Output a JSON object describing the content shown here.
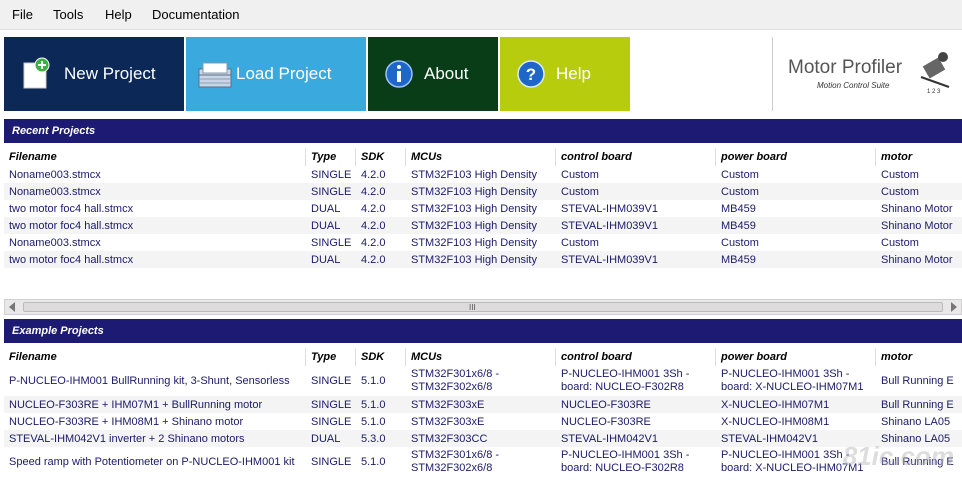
{
  "menu": [
    "File",
    "Tools",
    "Help",
    "Documentation"
  ],
  "toolbar": {
    "new_project": "New Project",
    "load_project": "Load Project",
    "about": "About",
    "help": "Help",
    "colors": {
      "new": "#0b2857",
      "load": "#3aa9de",
      "about": "#093d18",
      "help": "#b6cc0c"
    }
  },
  "logo": {
    "title": "Motor Profiler",
    "subtitle": "Motion Control Suite"
  },
  "recent": {
    "title": "Recent Projects",
    "columns": [
      "Filename",
      "Type",
      "SDK",
      "MCUs",
      "control board",
      "power board",
      "motor"
    ],
    "rows": [
      [
        "Noname003.stmcx",
        "SINGLE",
        "4.2.0",
        "STM32F103 High Density",
        "Custom",
        "Custom",
        "Custom"
      ],
      [
        "Noname003.stmcx",
        "SINGLE",
        "4.2.0",
        "STM32F103 High Density",
        "Custom",
        "Custom",
        "Custom"
      ],
      [
        "two motor foc4 hall.stmcx",
        "DUAL",
        "4.2.0",
        "STM32F103 High Density",
        "STEVAL-IHM039V1",
        "MB459",
        "Shinano Motor"
      ],
      [
        "two motor foc4 hall.stmcx",
        "DUAL",
        "4.2.0",
        "STM32F103 High Density",
        "STEVAL-IHM039V1",
        "MB459",
        "Shinano Motor"
      ],
      [
        "Noname003.stmcx",
        "SINGLE",
        "4.2.0",
        "STM32F103 High Density",
        "Custom",
        "Custom",
        "Custom"
      ],
      [
        "two motor foc4 hall.stmcx",
        "DUAL",
        "4.2.0",
        "STM32F103 High Density",
        "STEVAL-IHM039V1",
        "MB459",
        "Shinano Motor"
      ]
    ]
  },
  "example": {
    "title": "Example Projects",
    "columns": [
      "Filename",
      "Type",
      "SDK",
      "MCUs",
      "control board",
      "power board",
      "motor"
    ],
    "rows": [
      [
        "P-NUCLEO-IHM001 BullRunning kit, 3-Shunt, Sensorless",
        "SINGLE",
        "5.1.0",
        "STM32F301x6/8 - STM32F302x6/8",
        "P-NUCLEO-IHM001 3Sh - board: NUCLEO-F302R8",
        "P-NUCLEO-IHM001 3Sh - board: X-NUCLEO-IHM07M1",
        "Bull Running E"
      ],
      [
        "NUCLEO-F303RE + IHM07M1 + BullRunning motor",
        "SINGLE",
        "5.1.0",
        "STM32F303xE",
        "NUCLEO-F303RE",
        "X-NUCLEO-IHM07M1",
        "Bull Running E"
      ],
      [
        "NUCLEO-F303RE + IHM08M1 + Shinano motor",
        "SINGLE",
        "5.1.0",
        "STM32F303xE",
        "NUCLEO-F303RE",
        "X-NUCLEO-IHM08M1",
        "Shinano LA05"
      ],
      [
        "STEVAL-IHM042V1 inverter + 2 Shinano motors",
        "DUAL",
        "5.3.0",
        "STM32F303CC",
        "STEVAL-IHM042V1",
        "STEVAL-IHM042V1",
        "Shinano LA05"
      ],
      [
        "Speed ramp with Potentiometer on P-NUCLEO-IHM001 kit",
        "SINGLE",
        "5.1.0",
        "STM32F301x6/8 - STM32F302x6/8",
        "P-NUCLEO-IHM001 3Sh - board: NUCLEO-F302R8",
        "P-NUCLEO-IHM001 3Sh - board: X-NUCLEO-IHM07M1",
        "Bull Running E"
      ]
    ]
  },
  "scrollbar_grip": "III",
  "watermark": "81ic.com"
}
